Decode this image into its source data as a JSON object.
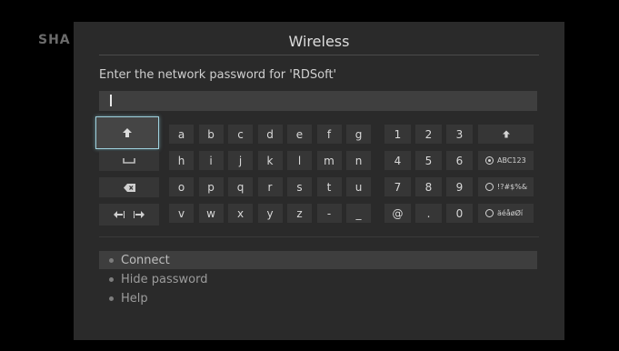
{
  "background": {
    "brand_partial": "SHA"
  },
  "dialog": {
    "title": "Wireless",
    "prompt": "Enter the network password for 'RDSoft'",
    "password_value": ""
  },
  "keyboard": {
    "letters": [
      [
        "a",
        "b",
        "c",
        "d",
        "e",
        "f",
        "g"
      ],
      [
        "h",
        "i",
        "j",
        "k",
        "l",
        "m",
        "n"
      ],
      [
        "o",
        "p",
        "q",
        "r",
        "s",
        "t",
        "u"
      ],
      [
        "v",
        "w",
        "x",
        "y",
        "z",
        "-",
        "_"
      ]
    ],
    "digits": [
      [
        "1",
        "2",
        "3"
      ],
      [
        "4",
        "5",
        "6"
      ],
      [
        "7",
        "8",
        "9"
      ],
      [
        "@",
        ".",
        "0"
      ]
    ],
    "function_keys": [
      "shift-icon",
      "space-icon",
      "backspace-icon",
      "cursor-arrows-icon"
    ],
    "modes": [
      "ABC123",
      "!?#$%&",
      "äéåøØí"
    ],
    "active_mode": "ABC123",
    "selected_key": "shift"
  },
  "menu": {
    "items": [
      "Connect",
      "Hide password",
      "Help"
    ],
    "selected": "Connect"
  },
  "colors": {
    "dialog_bg": "#2a2a2a",
    "key_bg": "#363636",
    "focus_outline": "#9fd1dd",
    "menu_highlight": "#3e3e3e"
  }
}
